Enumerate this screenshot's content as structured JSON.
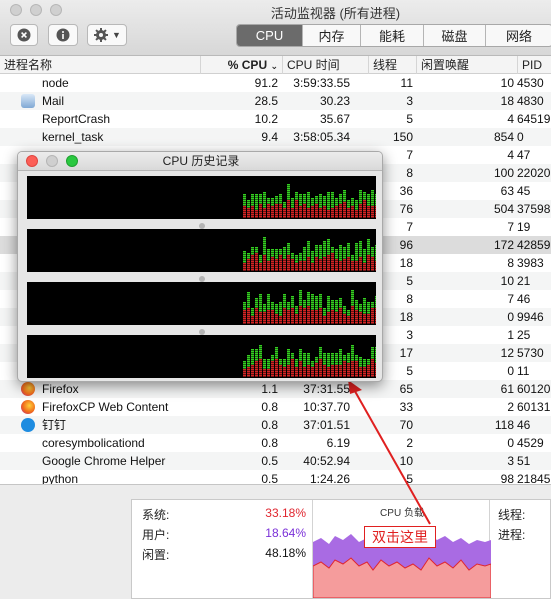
{
  "window": {
    "title": "活动监视器 (所有进程)",
    "tabs": [
      "CPU",
      "内存",
      "能耗",
      "磁盘",
      "网络"
    ],
    "active_tab": "CPU"
  },
  "table": {
    "columns": [
      "进程名称",
      "% CPU",
      "CPU 时间",
      "线程",
      "闲置唤醒",
      "PID"
    ],
    "sort_column": "% CPU",
    "rows": [
      {
        "name": "node",
        "cpu": "91.2",
        "time": "3:59:33.55",
        "threads": "11",
        "idle": "10",
        "pid": "4530",
        "icon": ""
      },
      {
        "name": "Mail",
        "cpu": "28.5",
        "time": "30.23",
        "threads": "3",
        "idle": "18",
        "pid": "4830",
        "icon": "mail-icon"
      },
      {
        "name": "ReportCrash",
        "cpu": "10.2",
        "time": "35.67",
        "threads": "5",
        "idle": "4",
        "pid": "64519",
        "icon": ""
      },
      {
        "name": "kernel_task",
        "cpu": "9.4",
        "time": "3:58:05.34",
        "threads": "150",
        "idle": "854",
        "pid": "0",
        "icon": ""
      },
      {
        "name": "",
        "cpu": "",
        "time": "",
        "threads": "7",
        "idle": "4",
        "pid": "47",
        "icon": ""
      },
      {
        "name": "",
        "cpu": "",
        "time": "",
        "threads": "8",
        "idle": "100",
        "pid": "22020",
        "icon": ""
      },
      {
        "name": "",
        "cpu": "",
        "time": "",
        "threads": "36",
        "idle": "63",
        "pid": "45",
        "icon": ""
      },
      {
        "name": "",
        "cpu": "",
        "time": "",
        "threads": "76",
        "idle": "504",
        "pid": "37598",
        "icon": ""
      },
      {
        "name": "",
        "cpu": "",
        "time": "",
        "threads": "7",
        "idle": "7",
        "pid": "19",
        "icon": ""
      },
      {
        "name": "",
        "cpu": "",
        "time": "",
        "threads": "96",
        "idle": "172",
        "pid": "42859",
        "icon": ""
      },
      {
        "name": "",
        "cpu": "",
        "time": "",
        "threads": "18",
        "idle": "8",
        "pid": "3983",
        "icon": ""
      },
      {
        "name": "",
        "cpu": "",
        "time": "",
        "threads": "5",
        "idle": "10",
        "pid": "21",
        "icon": ""
      },
      {
        "name": "",
        "cpu": "",
        "time": "",
        "threads": "8",
        "idle": "7",
        "pid": "46",
        "icon": ""
      },
      {
        "name": "",
        "cpu": "",
        "time": "",
        "threads": "18",
        "idle": "0",
        "pid": "9946",
        "icon": ""
      },
      {
        "name": "",
        "cpu": "",
        "time": "",
        "threads": "3",
        "idle": "1",
        "pid": "25",
        "icon": ""
      },
      {
        "name": "",
        "cpu": "",
        "time": "",
        "threads": "17",
        "idle": "12",
        "pid": "5730",
        "icon": ""
      },
      {
        "name": "",
        "cpu": "",
        "time": "",
        "threads": "5",
        "idle": "0",
        "pid": "11",
        "icon": ""
      },
      {
        "name": "Firefox",
        "cpu": "1.1",
        "time": "37:31.55",
        "threads": "65",
        "idle": "61",
        "pid": "60120",
        "icon": "firefox-icon"
      },
      {
        "name": "FirefoxCP Web Content",
        "cpu": "0.8",
        "time": "10:37.70",
        "threads": "33",
        "idle": "2",
        "pid": "60131",
        "icon": "firefox-icon"
      },
      {
        "name": "钉钉",
        "cpu": "0.8",
        "time": "37:01.51",
        "threads": "70",
        "idle": "118",
        "pid": "46",
        "icon": "dingtalk-icon"
      },
      {
        "name": "coresymbolicationd",
        "cpu": "0.8",
        "time": "6.19",
        "threads": "2",
        "idle": "0",
        "pid": "4529",
        "icon": ""
      },
      {
        "name": "Google Chrome Helper",
        "cpu": "0.5",
        "time": "40:52.94",
        "threads": "10",
        "idle": "3",
        "pid": "51",
        "icon": ""
      },
      {
        "name": "python",
        "cpu": "0.5",
        "time": "1:24.26",
        "threads": "5",
        "idle": "98",
        "pid": "21845",
        "icon": ""
      }
    ]
  },
  "summary": {
    "system_label": "系统:",
    "system_value": "33.18%",
    "user_label": "用户:",
    "user_value": "18.64%",
    "idle_label": "闲置:",
    "idle_value": "48.18%",
    "load_title": "CPU 负载",
    "threads_label": "线程:",
    "processes_label": "进程:"
  },
  "history_window": {
    "title": "CPU 历史记录",
    "cores": 4
  },
  "annotation": {
    "text": "双击这里"
  },
  "colors": {
    "system": "#e0262f",
    "user": "#3c8c20",
    "user_value": "#7a30d8",
    "graph_green": "#34d020",
    "graph_red": "#d42424",
    "annotation": "#e02020"
  }
}
